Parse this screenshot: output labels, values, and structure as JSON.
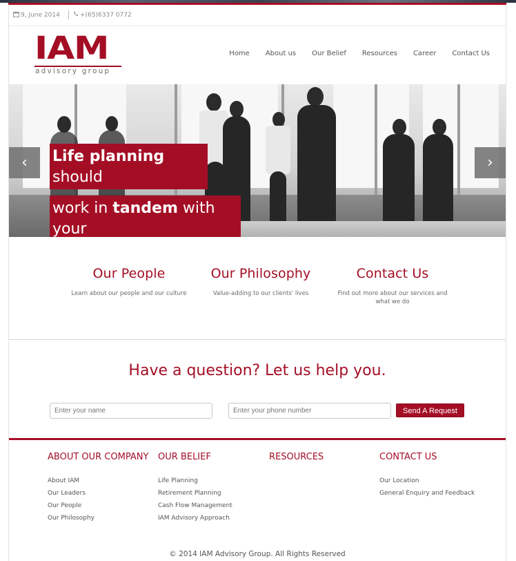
{
  "topbar": {
    "date": "9, June 2014",
    "phone": "+(65)6337 0772",
    "calendar_icon": "calendar-icon",
    "phone_icon": "phone-icon"
  },
  "logo": {
    "brand": "IAM",
    "tagline": "advisory group"
  },
  "nav": {
    "items": [
      "Home",
      "About us",
      "Our Belief",
      "Resources",
      "Career",
      "Contact Us"
    ]
  },
  "hero": {
    "caption_line1_bold": "Life planning",
    "caption_line1_rest": "should",
    "caption_line2_pre": "work in ",
    "caption_line2_bold": "tandem",
    "caption_line2_post": " with",
    "caption_line3": "your",
    "prev_symbol": "‹",
    "next_symbol": "›"
  },
  "features": [
    {
      "title": "Our People",
      "text": "Learn about our people and our culture"
    },
    {
      "title": "Our Philosophy",
      "text": "Value-adding to our clients' lives"
    },
    {
      "title": "Contact Us",
      "text": "Find out more about our services and what we do"
    }
  ],
  "cta": {
    "heading": "Have a question? Let us help you.",
    "name_placeholder": "Enter your name",
    "phone_placeholder": "Enter your phone number",
    "button": "Send A Request"
  },
  "footer": {
    "columns": [
      {
        "heading": "ABOUT OUR COMPANY",
        "links": [
          "About IAM",
          "Our Leaders",
          "Our People",
          "Our Philosophy"
        ]
      },
      {
        "heading": "OUR BELIEF",
        "links": [
          "Life Planning",
          "Retirement Planning",
          "Cash Flow Management",
          "IAM Advisory Approach"
        ]
      },
      {
        "heading": "RESOURCES",
        "links": []
      },
      {
        "heading": "CONTACT US",
        "links": [
          "Our Location",
          "General Enquiry and Feedback"
        ]
      }
    ],
    "copyright": "© 2014 IAM Advisory Group. All Rights Reserved"
  },
  "colors": {
    "brand": "#a40e25",
    "text": "#555555"
  }
}
